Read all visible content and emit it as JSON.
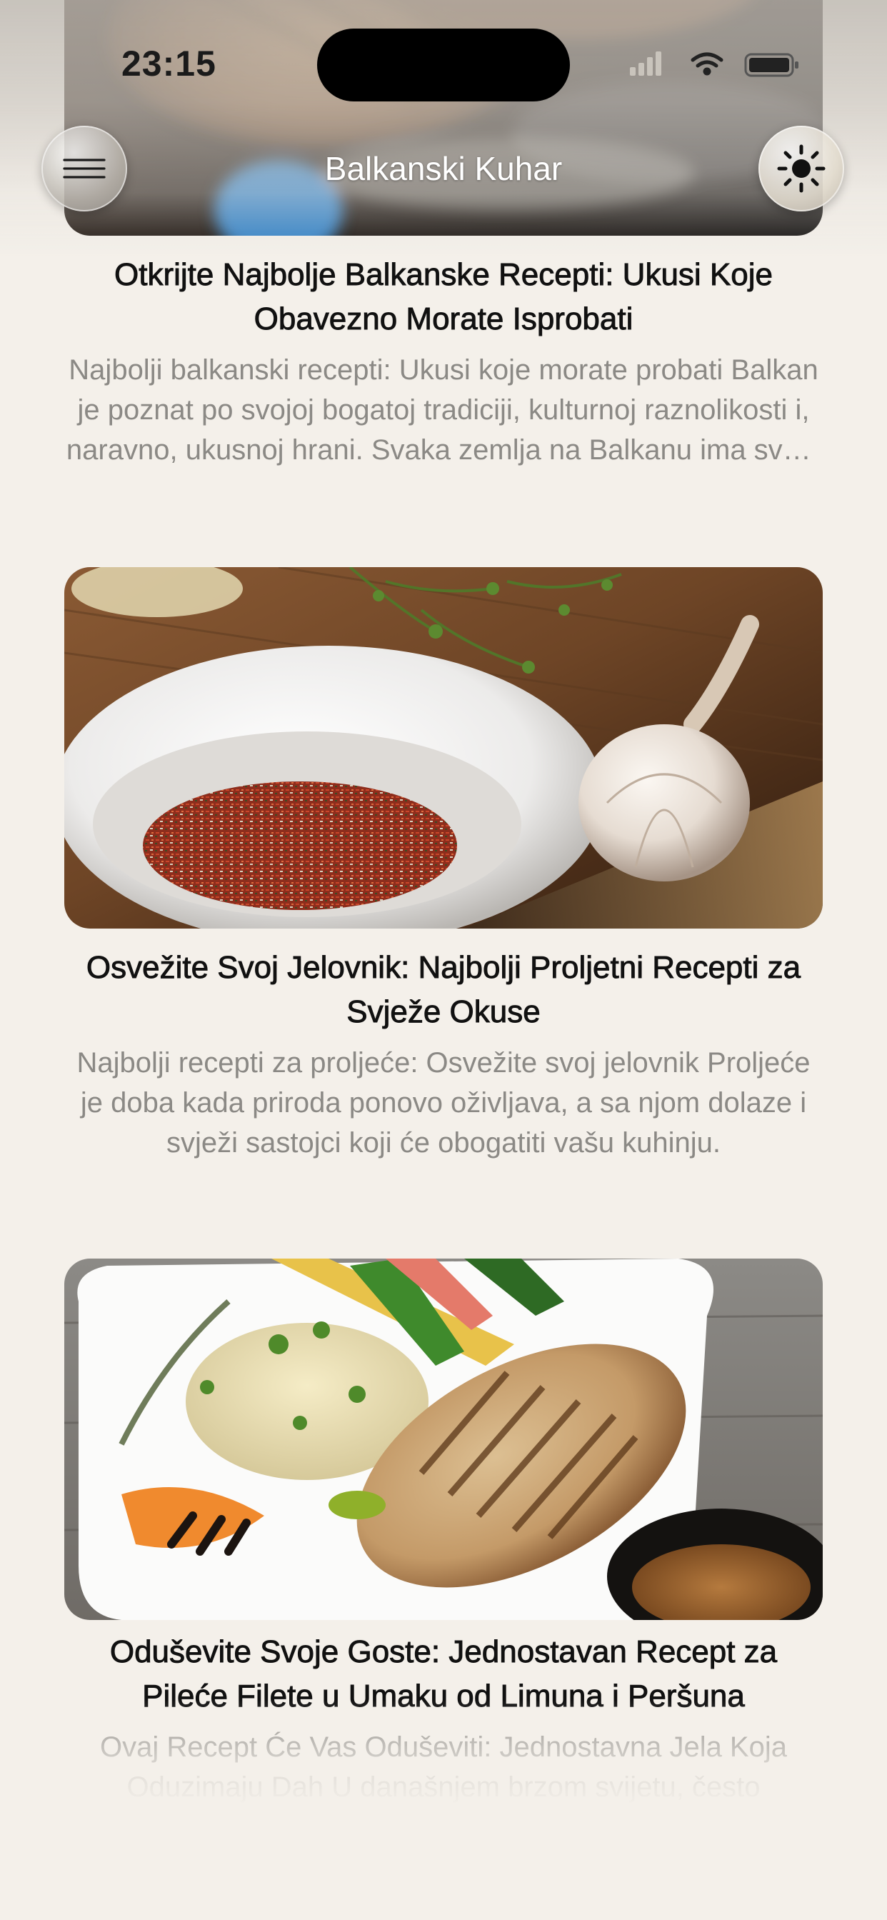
{
  "status_bar": {
    "time": "23:15"
  },
  "header": {
    "title": "Balkanski Kuhar",
    "menu_icon": "hamburger-menu-icon",
    "theme_icon": "sun-icon"
  },
  "articles": [
    {
      "title": "Otkrijte Najbolje Balkanske Recepti: Ukusi Koje Obavezno Morate Isprobati",
      "excerpt": "Najbolji balkanski recepti: Ukusi koje morate probati Balkan je poznat po svojoj bogatoj tradiciji, kulturnoj raznolikosti i, naravno, ukusnoj hrani. Svaka zemlja na Balkanu ima svoje specijalitete.",
      "image": "grilled-meat-photo"
    },
    {
      "title": "Osvežite Svoj Jelovnik: Najbolji Proljetni Recepti za Svježe Okuse",
      "excerpt": "Najbolji recepti za proljeće: Osvežite svoj jelovnik Proljeće je doba kada priroda ponovo oživljava, a sa njom dolaze i svježi sastojci koji će obogatiti vašu kuhinju.",
      "image": "spices-and-garlic-photo"
    },
    {
      "title": "Oduševite Svoje Goste: Jednostavan Recept za Pileće Filete u Umaku od Limuna i Peršuna",
      "excerpt": "Ovaj Recept Će Vas Oduševiti: Jednostavna Jela Koja Oduzimaju Dah U današnjem brzom svijetu, često",
      "image": "grilled-chicken-plate-photo"
    }
  ]
}
